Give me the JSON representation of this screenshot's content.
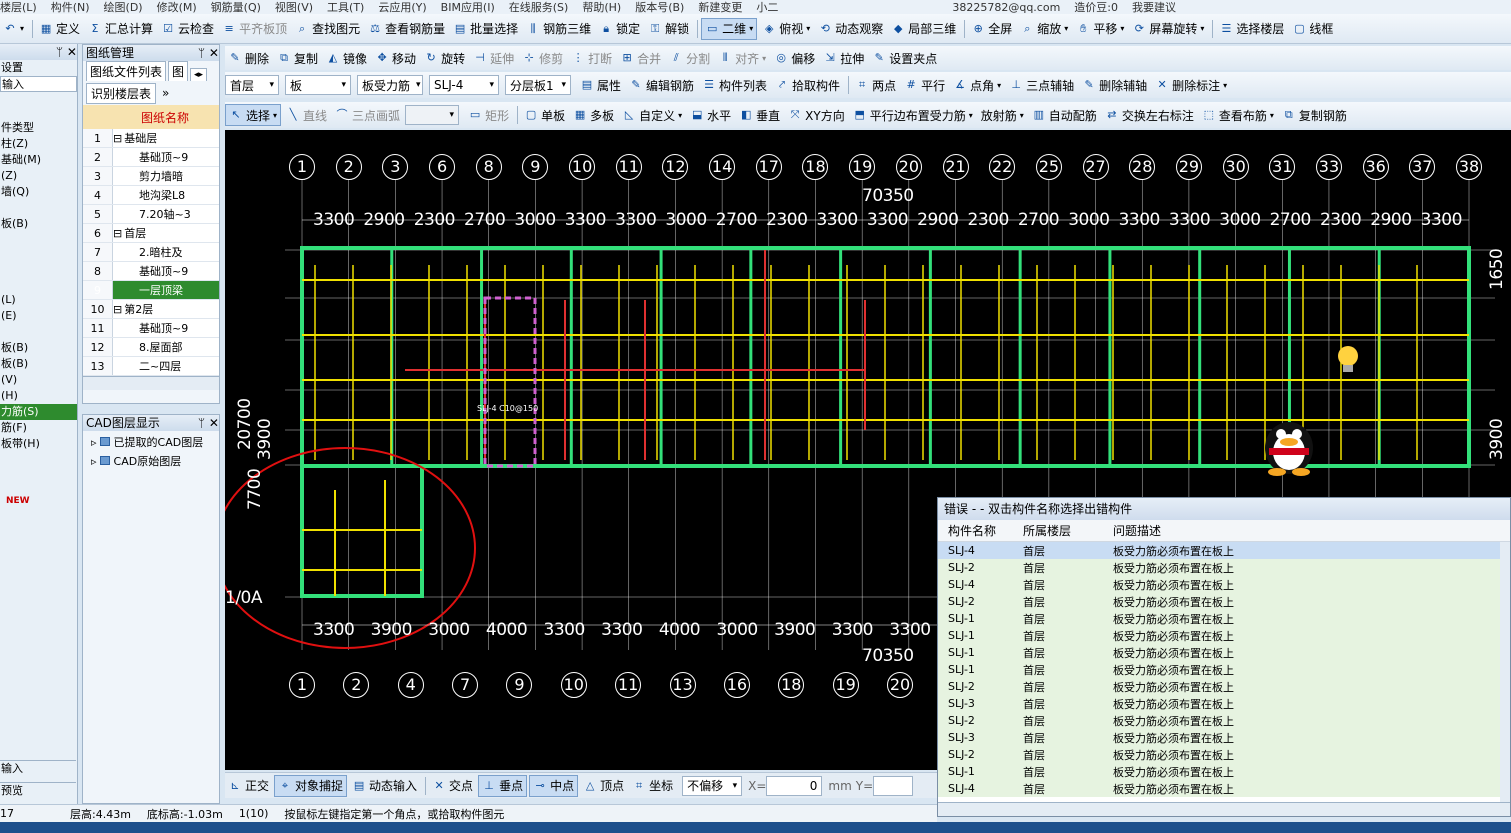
{
  "menubar": {
    "items": [
      "楼层(L)",
      "构件(N)",
      "绘图(D)",
      "修改(M)",
      "钢筋量(Q)",
      "视图(V)",
      "工具(T)",
      "云应用(Y)",
      "BIM应用(I)",
      "在线服务(S)",
      "帮助(H)",
      "版本号(B)",
      "新建变更",
      "小二"
    ],
    "right_text": "38225782@qq.com",
    "right_link": "造价豆:0",
    "login": "我要建议"
  },
  "toolbar1": {
    "undo": "↶",
    "define": "定义",
    "total": "汇总计算",
    "cloud_check": "云检查",
    "align_top": "平齐板顶",
    "find": "查找图元",
    "view_qty": "查看钢筋量",
    "batch_select": "批量选择",
    "rebar3d": "钢筋三维",
    "lock": "锁定",
    "unlock": "解锁",
    "view2d": "二维",
    "topview": "俯视",
    "dyn_view": "动态观察",
    "local3d": "局部三维",
    "fullscreen": "全屏",
    "zoom": "缩放",
    "pan": "平移",
    "rotate": "屏幕旋转",
    "select_floor": "选择楼层",
    "linework": "线框"
  },
  "toolbar2": {
    "delete": "删除",
    "copy": "复制",
    "mirror": "镜像",
    "move": "移动",
    "rotate": "旋转",
    "extend": "延伸",
    "trim": "修剪",
    "break": "打断",
    "merge": "合并",
    "split": "分割",
    "align": "对齐",
    "offset": "偏移",
    "stretch": "拉伸",
    "grip": "设置夹点"
  },
  "toolbar3": {
    "floor": "首层",
    "category": "板",
    "type": "板受力筋",
    "name": "SLJ-4",
    "layer": "分层板1",
    "props": "属性",
    "edit_rebar": "编辑钢筋",
    "comp_list": "构件列表",
    "pick": "拾取构件",
    "two_pts": "两点",
    "parallel": "平行",
    "point_angle": "点角",
    "three_pt_axis": "三点辅轴",
    "del_axis": "删除辅轴",
    "del_dim": "删除标注"
  },
  "toolbar4": {
    "select": "选择",
    "line": "直线",
    "arc3": "三点画弧",
    "rect": "矩形",
    "single_slab": "单板",
    "multi_slab": "多板",
    "custom": "自定义",
    "horizontal": "水平",
    "vertical": "垂直",
    "xy": "XY方向",
    "parallel_edge": "平行边布置受力筋",
    "radial": "放射筋",
    "auto": "自动配筋",
    "swap": "交换左右标注",
    "view_layout": "查看布筋",
    "copy_rebar": "复制钢筋"
  },
  "leftnav": {
    "items": [
      "设置",
      "输入",
      "",
      "件类型",
      "柱(Z)",
      "基础(M)",
      "(Z)",
      "墙(Q)",
      "",
      "板(B)",
      "",
      "",
      "",
      "",
      "(L)",
      "(E)",
      "",
      "板(B)",
      "板(B)",
      "(V)",
      "(H)",
      "力筋(S)",
      "筋(F)",
      "板带(H)",
      "",
      "",
      "NEW"
    ],
    "bottom1": "输入",
    "bottom2": "预览"
  },
  "drawpanel": {
    "title": "图纸管理",
    "tab1": "图纸文件列表",
    "tab2": "图",
    "identify": "识别楼层表",
    "col_header": "图纸名称",
    "rows": [
      {
        "n": "1",
        "t": "基础层",
        "group": true
      },
      {
        "n": "2",
        "t": "基础顶~9"
      },
      {
        "n": "3",
        "t": "剪力墙暗"
      },
      {
        "n": "4",
        "t": "地沟梁L8"
      },
      {
        "n": "5",
        "t": "7.20轴~3"
      },
      {
        "n": "6",
        "t": "首层",
        "group": true
      },
      {
        "n": "7",
        "t": "2.暗柱及"
      },
      {
        "n": "8",
        "t": "基础顶~9"
      },
      {
        "n": "9",
        "t": "一层顶梁",
        "active": true
      },
      {
        "n": "10",
        "t": "第2层",
        "group": true
      },
      {
        "n": "11",
        "t": "基础顶~9"
      },
      {
        "n": "12",
        "t": "8.屋面部"
      },
      {
        "n": "13",
        "t": "二~四层"
      }
    ]
  },
  "cadpanel": {
    "title": "CAD图层显示",
    "layer1": "已提取的CAD图层",
    "layer2": "CAD原始图层"
  },
  "canvas": {
    "top_axes": [
      "1",
      "2",
      "3",
      "6",
      "8",
      "9",
      "10",
      "11",
      "12",
      "14",
      "17",
      "18",
      "19",
      "20",
      "21",
      "22",
      "25",
      "27",
      "28",
      "29",
      "30",
      "31",
      "33",
      "36",
      "37",
      "38"
    ],
    "bottom_axes": [
      "1",
      "2",
      "4",
      "7",
      "9",
      "10",
      "11",
      "13",
      "16",
      "18",
      "19",
      "20"
    ],
    "top_total": "70350",
    "bottom_total": "70350",
    "top_dims": [
      "3300",
      "2900",
      "2300",
      "2700",
      "3000",
      "3300",
      "3300",
      "3000",
      "2700",
      "2300",
      "3300",
      "3300",
      "2900",
      "2300",
      "2700",
      "3000",
      "3300",
      "3300",
      "3000",
      "2700",
      "2300",
      "2900",
      "3300"
    ],
    "bottom_dims": [
      "3300",
      "3900",
      "3000",
      "4000",
      "3300",
      "3300",
      "4000",
      "3000",
      "3900",
      "3300",
      "3300"
    ],
    "left_dims": [
      "7700",
      "20700",
      "3900",
      "1/0A"
    ],
    "right_dims": [
      "3900",
      "1650"
    ],
    "slab_label": "SLJ-4 C10@150"
  },
  "err": {
    "title": "错误 - - 双击构件名称选择出错构件",
    "headers": [
      "构件名称",
      "所属楼层",
      "问题描述"
    ],
    "rows": [
      [
        "SLJ-4",
        "首层",
        "板受力筋必须布置在板上"
      ],
      [
        "SLJ-2",
        "首层",
        "板受力筋必须布置在板上"
      ],
      [
        "SLJ-4",
        "首层",
        "板受力筋必须布置在板上"
      ],
      [
        "SLJ-2",
        "首层",
        "板受力筋必须布置在板上"
      ],
      [
        "SLJ-1",
        "首层",
        "板受力筋必须布置在板上"
      ],
      [
        "SLJ-1",
        "首层",
        "板受力筋必须布置在板上"
      ],
      [
        "SLJ-1",
        "首层",
        "板受力筋必须布置在板上"
      ],
      [
        "SLJ-1",
        "首层",
        "板受力筋必须布置在板上"
      ],
      [
        "SLJ-2",
        "首层",
        "板受力筋必须布置在板上"
      ],
      [
        "SLJ-3",
        "首层",
        "板受力筋必须布置在板上"
      ],
      [
        "SLJ-2",
        "首层",
        "板受力筋必须布置在板上"
      ],
      [
        "SLJ-3",
        "首层",
        "板受力筋必须布置在板上"
      ],
      [
        "SLJ-2",
        "首层",
        "板受力筋必须布置在板上"
      ],
      [
        "SLJ-1",
        "首层",
        "板受力筋必须布置在板上"
      ],
      [
        "SLJ-4",
        "首层",
        "板受力筋必须布置在板上"
      ]
    ]
  },
  "snap": {
    "ortho": "正交",
    "osnap": "对象捕捉",
    "dyn_input": "动态输入",
    "intersect": "交点",
    "perp": "垂点",
    "mid": "中点",
    "vertex": "顶点",
    "coord": "坐标",
    "no_offset": "不偏移",
    "x_label": "X=",
    "x_val": "0",
    "mm": "mm",
    "y_label": "Y="
  },
  "status": {
    "left": "17",
    "floor_h": "层高:4.43m",
    "base_h": "底标高:-1.03m",
    "count": "1(10)",
    "prompt": "按鼠标左键指定第一个角点，或拾取构件图元"
  },
  "colors": {
    "wall": "#33e07a",
    "beam": "#f0e000",
    "rebar": "#e03030",
    "axis": "#ffffff"
  }
}
